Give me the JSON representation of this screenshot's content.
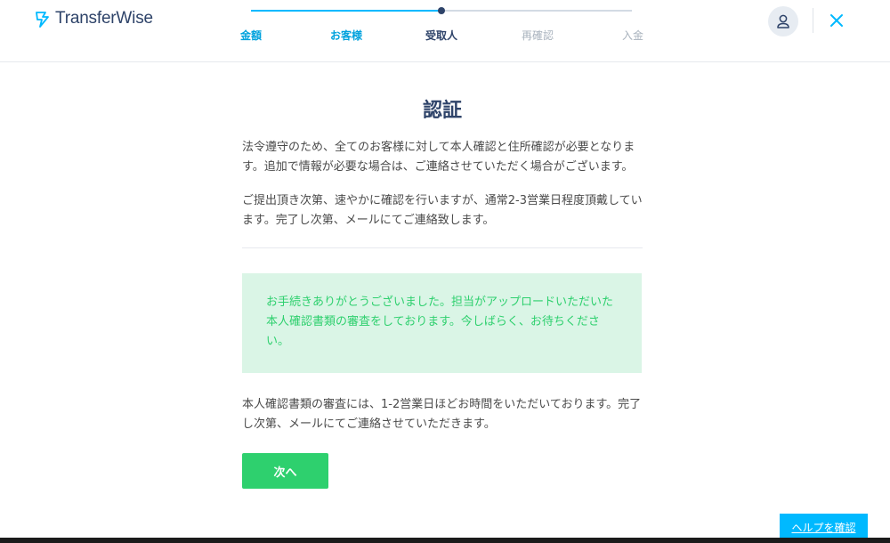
{
  "header": {
    "logo_text": "TransferWise",
    "steps": [
      {
        "label": "金額",
        "state": "done"
      },
      {
        "label": "お客様",
        "state": "done"
      },
      {
        "label": "受取人",
        "state": "current"
      },
      {
        "label": "再確認",
        "state": "future"
      },
      {
        "label": "入金",
        "state": "future"
      }
    ],
    "progress": 0.5
  },
  "main": {
    "title": "認証",
    "intro_1": "法令遵守のため、全てのお客様に対して本人確認と住所確認が必要となります。追加で情報が必要な場合は、ご連絡させていただく場合がございます。",
    "intro_2": "ご提出頂き次第、速やかに確認を行いますが、通常2-3営業日程度頂戴しています。完了し次第、メールにてご連絡致します。",
    "alert_text": "お手続きありがとうございました。担当がアップロードいただいた本人確認書類の審査をしております。今しばらく、お待ちください。",
    "note": "本人確認書類の審査には、1-2営業日ほどお時間をいただいております。完了し次第、メールにてご連絡させていただきます。",
    "next_label": "次へ"
  },
  "help_label": "ヘルプを確認",
  "colors": {
    "navy": "#2e4369",
    "accent_blue": "#00b9ff",
    "success_green": "#2ed06e",
    "alert_bg": "#daf5e6"
  }
}
